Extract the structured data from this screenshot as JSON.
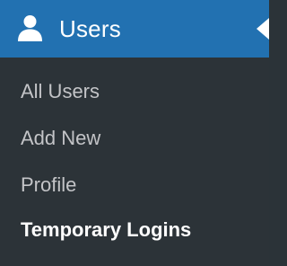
{
  "header": {
    "icon": "user-icon",
    "label": "Users",
    "background_color": "#2271b1"
  },
  "submenu": {
    "items": [
      {
        "label": "All Users",
        "current": false
      },
      {
        "label": "Add New",
        "current": false
      },
      {
        "label": "Profile",
        "current": false
      },
      {
        "label": "Temporary Logins",
        "current": true
      }
    ],
    "text_color": "#c3c4c7",
    "current_text_color": "#ffffff",
    "background_color": "#2c3338"
  }
}
